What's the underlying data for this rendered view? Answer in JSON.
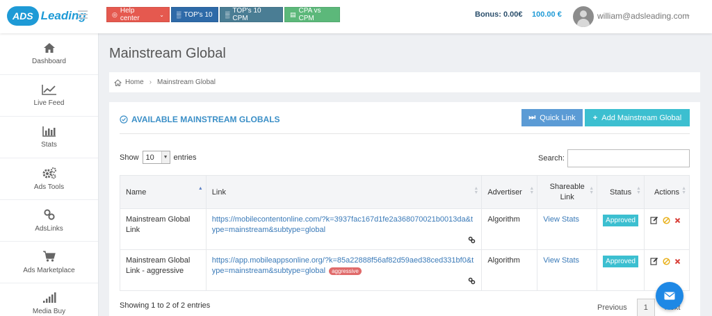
{
  "header": {
    "logo_badge": "ADS",
    "logo_text": "Leading",
    "buttons": {
      "help": "Help center",
      "top10": "TOP's 10",
      "top10cpm": "TOP's 10 CPM",
      "cpa_vs_cpm": "CPA vs CPM"
    },
    "bonus": "Bonus: 0.00€",
    "balance": "100.00 €",
    "user_email": "william@adsleading.com"
  },
  "sidebar": {
    "items": [
      {
        "label": "Dashboard",
        "icon": "home-icon"
      },
      {
        "label": "Live Feed",
        "icon": "line-chart-icon"
      },
      {
        "label": "Stats",
        "icon": "bar-chart-icon"
      },
      {
        "label": "Ads Tools",
        "icon": "gears-icon"
      },
      {
        "label": "AdsLinks",
        "icon": "link-icon"
      },
      {
        "label": "Ads Marketplace",
        "icon": "cart-icon"
      },
      {
        "label": "Media Buy",
        "icon": "signal-icon"
      }
    ]
  },
  "page": {
    "title": "Mainstream Global",
    "breadcrumb": {
      "home": "Home",
      "current": "Mainstream Global"
    }
  },
  "panel": {
    "title": "AVAILABLE MAINSTREAM GLOBALS",
    "quick_link": "Quick Link",
    "add_button": "Add Mainstream Global",
    "show_label": "Show",
    "entries_label": "entries",
    "page_size": "10",
    "search_label": "Search:",
    "search_value": ""
  },
  "table": {
    "columns": [
      "Name",
      "Link",
      "Advertiser",
      "Shareable Link",
      "Status",
      "Actions"
    ],
    "rows": [
      {
        "name": "Mainstream Global Link",
        "link": "https://mobilecontentonline.com/?k=3937fac167d1fe2a368070021b0013da&type=mainstream&subtype=global",
        "tag": "",
        "advertiser": "Algorithm",
        "shareable": "View Stats",
        "status": "Approved"
      },
      {
        "name": "Mainstream Global Link - aggressive",
        "link": "https://app.mobileappsonline.org/?k=85a22888f56af82d59aed38ced331bf0&type=mainstream&subtype=global",
        "tag": "aggressive",
        "advertiser": "Algorithm",
        "shareable": "View Stats",
        "status": "Approved"
      }
    ]
  },
  "footer": {
    "showing": "Showing 1 to 2 of 2 entries",
    "previous": "Previous",
    "current_page": "1",
    "next": "Next"
  },
  "colors": {
    "brand": "#1e9ad6",
    "help": "#e5594f",
    "top10": "#2e6aa8",
    "top10cpm": "#4a7d94",
    "cpa": "#5cb87a",
    "approved": "#3cbfd0",
    "aggressive": "#e06a6a"
  }
}
